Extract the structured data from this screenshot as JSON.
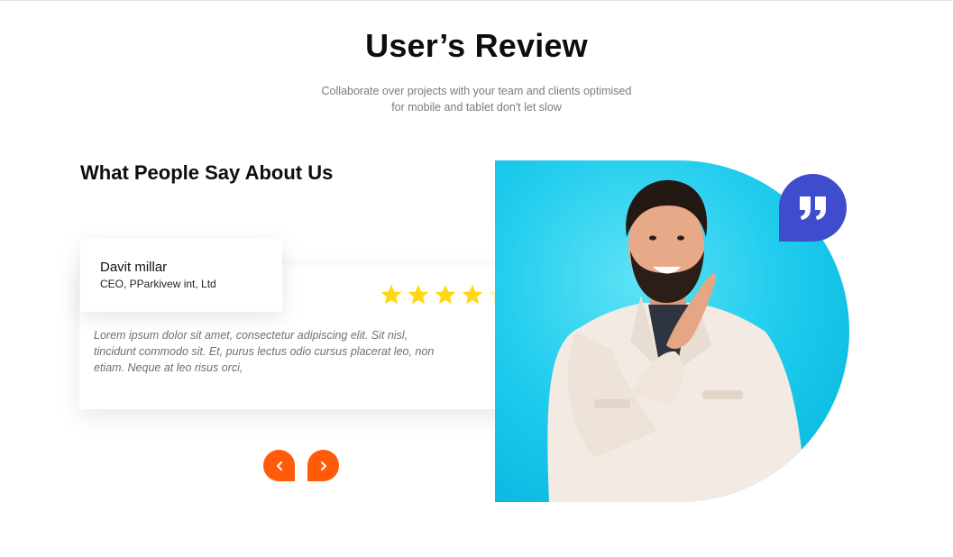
{
  "header": {
    "title": "User’s Review",
    "subtitle_line1": "Collaborate over projects with your team and clients optimised",
    "subtitle_line2": "for mobile and tablet don't let slow"
  },
  "testimonial": {
    "heading": "What People Say About Us",
    "reviewer_name": "Davit millar",
    "reviewer_role": "CEO, PParkivew int, Ltd",
    "rating": 4,
    "rating_max": 5,
    "review_line1": "Lorem ipsum dolor sit amet, consectetur adipiscing elit. Sit nisl,",
    "review_line2": "tincidunt commodo sit. Et, purus lectus odio cursus placerat leo, non",
    "review_line3": "etiam. Neque at leo risus orci,"
  },
  "navigation": {
    "prev_icon": "chevron-left-icon",
    "next_icon": "chevron-right-icon"
  },
  "icons": {
    "quote": "quote-icon",
    "star": "star-icon"
  },
  "colors": {
    "accent_orange": "#ff5b0a",
    "quote_badge": "#3f4ccc",
    "photo_background": "#22cdee",
    "star_filled": "#ffd814",
    "star_empty": "#fff2b8"
  }
}
